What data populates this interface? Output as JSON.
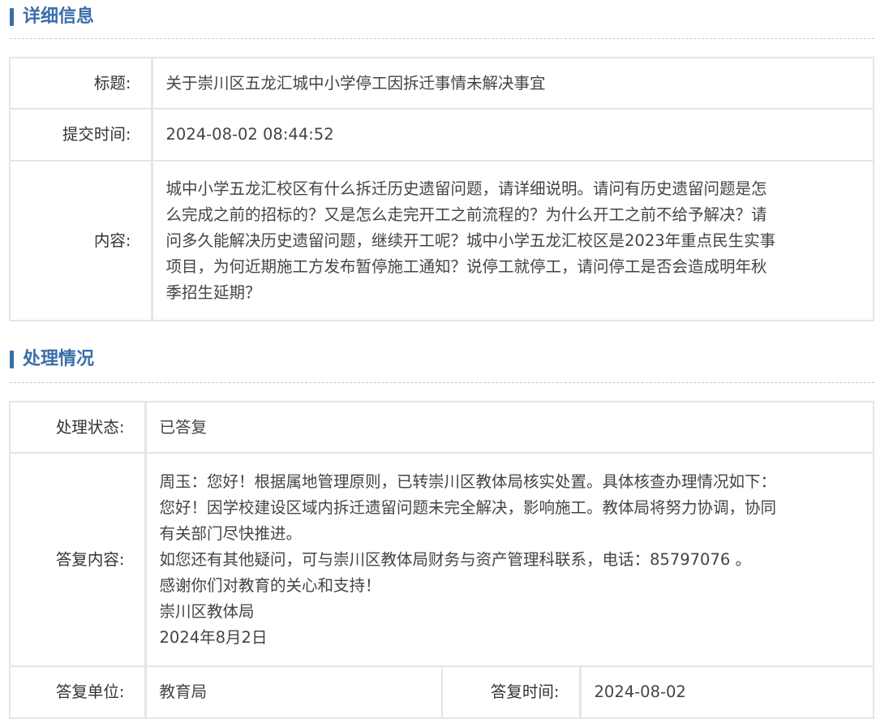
{
  "detail": {
    "title": "详细信息",
    "rows": [
      {
        "label": "标题:",
        "value": "关于崇川区五龙汇城中小学停工因拆迁事情未解决事宜"
      },
      {
        "label": "提交时间:",
        "value": "2024-08-02 08:44:52"
      },
      {
        "label": "内容:",
        "value": "城中小学五龙汇校区有什么拆迁历史遗留问题，请详细说明。请问有历史遗留问题是怎\n么完成之前的招标的？又是怎么走完开工之前流程的？为什么开工之前不给予解决？请\n问多久能解决历史遗留问题，继续开工呢？城中小学五龙汇校区是2023年重点民生实事\n项目，为何近期施工方发布暂停施工通知？说停工就停工，请问停工是否会造成明年秋\n季招生延期？"
      }
    ]
  },
  "processing": {
    "title": "处理情况",
    "status_label": "处理状态:",
    "status_value": "已答复",
    "reply_label": "答复内容:",
    "reply_value": "周玉：您好！根据属地管理原则，已转崇川区教体局核实处置。具体核查办理情况如下：\n您好！因学校建设区域内拆迁遗留问题未完全解决，影响施工。教体局将努力协调，协同\n有关部门尽快推进。\n如您还有其他疑问，可与崇川区教体局财务与资产管理科联系，电话：85797076 。\n感谢你们对教育的关心和支持！\n崇川区教体局\n2024年8月2日",
    "unit_label": "答复单位:",
    "unit_value": "教育局",
    "time_label": "答复时间:",
    "time_value": "2024-08-02"
  }
}
